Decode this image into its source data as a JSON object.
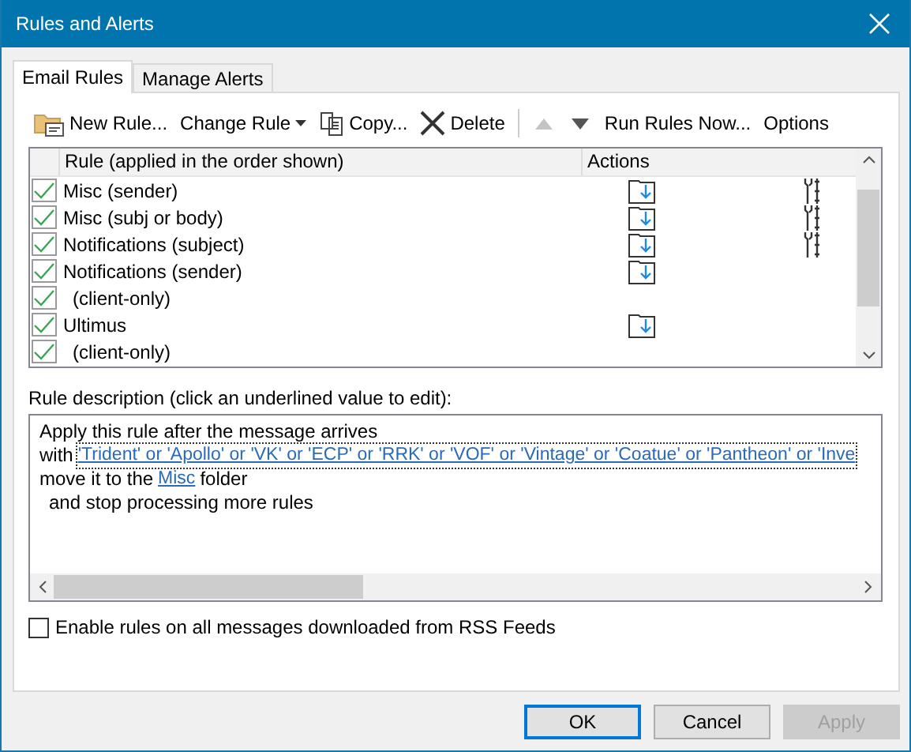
{
  "window": {
    "title": "Rules and Alerts"
  },
  "tabs": [
    {
      "label": "Email Rules",
      "selected": true
    },
    {
      "label": "Manage Alerts",
      "selected": false
    }
  ],
  "toolbar": [
    {
      "kind": "new",
      "label": "New Rule...",
      "disabled": false
    },
    {
      "kind": "change",
      "label": "Change Rule",
      "disabled": false
    },
    {
      "kind": "copy",
      "label": "Copy...",
      "disabled": false
    },
    {
      "kind": "delete",
      "label": "Delete",
      "disabled": false
    },
    {
      "kind": "up",
      "disabled": true
    },
    {
      "kind": "down",
      "disabled": false
    },
    {
      "kind": "text",
      "label": "Run Rules Now...",
      "disabled": false
    },
    {
      "kind": "text",
      "label": "Options",
      "disabled": false
    }
  ],
  "table": {
    "columns": [
      "Rule (applied in the order shown)",
      "Actions"
    ],
    "rows": [
      {
        "name": "Misc (sender)",
        "checked": true,
        "sub": false,
        "move_action": true,
        "tool_action": true
      },
      {
        "name": "Misc (subj or body)",
        "checked": true,
        "sub": false,
        "move_action": true,
        "tool_action": true
      },
      {
        "name": "Notifications (subject)",
        "checked": true,
        "sub": false,
        "move_action": true,
        "tool_action": true
      },
      {
        "name": "Notifications (sender)",
        "checked": true,
        "sub": false,
        "move_action": true,
        "tool_action": false
      },
      {
        "name": "(client-only)",
        "checked": true,
        "sub": true,
        "move_action": false,
        "tool_action": false
      },
      {
        "name": "Ultimus",
        "checked": true,
        "sub": false,
        "move_action": true,
        "tool_action": false
      },
      {
        "name": "(client-only)",
        "checked": true,
        "sub": true,
        "move_action": false,
        "tool_action": false
      }
    ]
  },
  "description": {
    "label": "Rule description (click an underlined value to edit):",
    "lines": [
      [
        {
          "kind": "text",
          "text": "Apply this rule after the message arrives"
        }
      ],
      [
        {
          "kind": "text",
          "text": "with"
        },
        {
          "kind": "link",
          "text": "'Trident' or 'Apollo' or 'VK' or 'ECP' or 'RRK' or 'VOF' or 'Vintage' or 'Coatue' or 'Pantheon' or 'Inve",
          "focused": true
        }
      ],
      [
        {
          "kind": "text",
          "text": "move it to the"
        },
        {
          "kind": "link",
          "text": "Misc",
          "focused": false
        },
        {
          "kind": "text",
          "text": "folder"
        }
      ],
      [
        {
          "kind": "text",
          "text": "and stop processing more rules",
          "indent": true
        }
      ]
    ]
  },
  "rss_checkbox": {
    "label": "Enable rules on all messages downloaded from RSS Feeds",
    "checked": false
  },
  "buttons": [
    {
      "label": "OK",
      "default": true,
      "disabled": false
    },
    {
      "label": "Cancel",
      "default": false,
      "disabled": false
    },
    {
      "label": "Apply",
      "default": false,
      "disabled": true
    }
  ]
}
